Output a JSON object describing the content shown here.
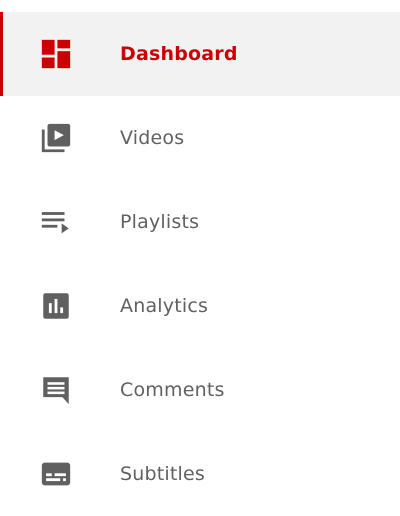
{
  "colors": {
    "active": "#cc0000",
    "icon": "#606060",
    "label": "#606060",
    "active_background": "#f2f2f2"
  },
  "nav": {
    "items": [
      {
        "label": "Dashboard",
        "icon": "dashboard-icon",
        "active": true
      },
      {
        "label": "Videos",
        "icon": "video-library-icon",
        "active": false
      },
      {
        "label": "Playlists",
        "icon": "playlist-icon",
        "active": false
      },
      {
        "label": "Analytics",
        "icon": "analytics-icon",
        "active": false
      },
      {
        "label": "Comments",
        "icon": "comment-icon",
        "active": false
      },
      {
        "label": "Subtitles",
        "icon": "subtitles-icon",
        "active": false
      }
    ]
  }
}
